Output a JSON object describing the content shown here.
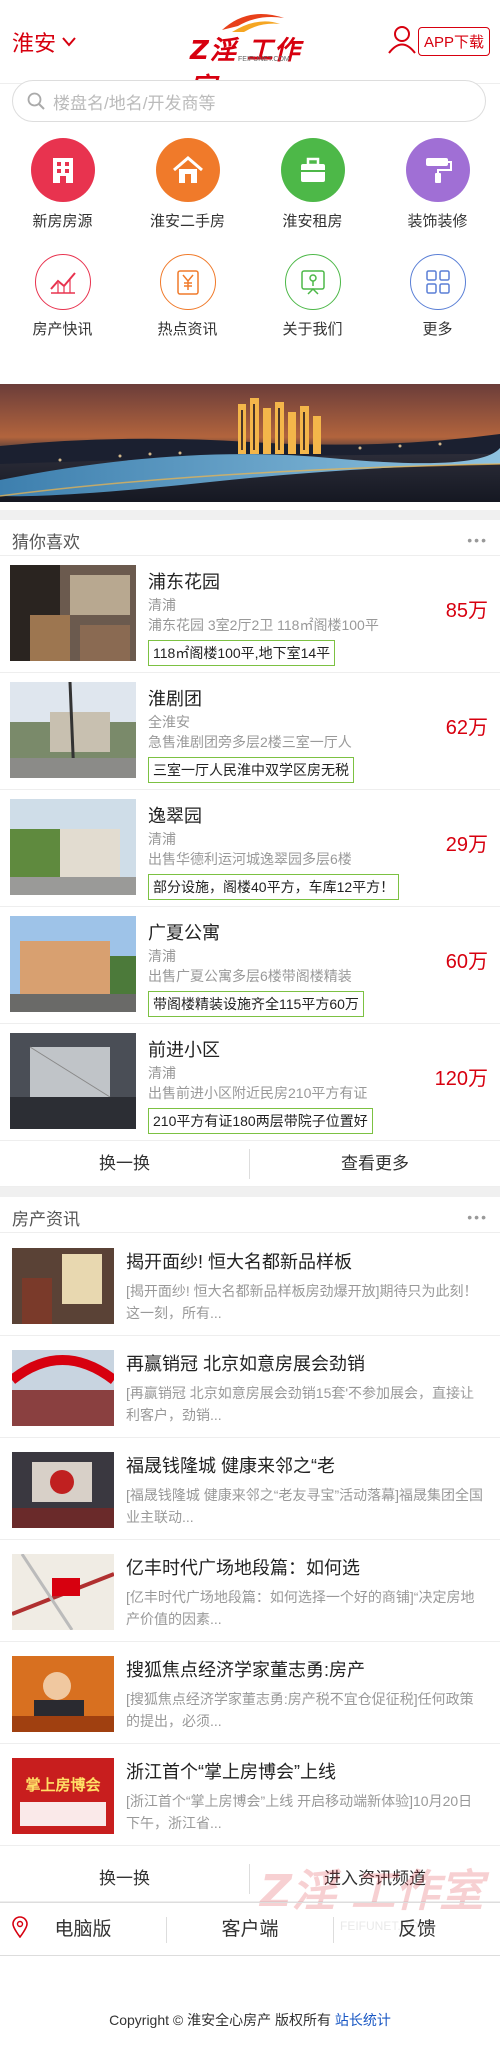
{
  "header": {
    "city": "淮安",
    "logo_brand": "Z淫 工作室",
    "logo_sub": "FEIFUNET.COM",
    "app_download": "APP下载"
  },
  "search": {
    "placeholder": "楼盘名/地名/开发商等"
  },
  "nav": [
    {
      "label": "新房房源",
      "icon": "building-icon",
      "color": "#e8334f"
    },
    {
      "label": "淮安二手房",
      "icon": "house-icon",
      "color": "#f07a2a"
    },
    {
      "label": "淮安租房",
      "icon": "briefcase-icon",
      "color": "#4db848"
    },
    {
      "label": "装饰装修",
      "icon": "paint-roller-icon",
      "color": "#a06fd5"
    },
    {
      "label": "房产快讯",
      "icon": "chart-icon",
      "color": "#e8334f"
    },
    {
      "label": "热点资讯",
      "icon": "yen-icon",
      "color": "#f07a2a"
    },
    {
      "label": "关于我们",
      "icon": "info-board-icon",
      "color": "#4db848"
    },
    {
      "label": "更多",
      "icon": "grid-icon",
      "color": "#5a7fd6"
    }
  ],
  "guess": {
    "title": "猜你喜欢",
    "more": "•••",
    "items": [
      {
        "name": "浦东花园",
        "area": "清浦",
        "desc": "浦东花园 3室2厅2卫 118㎡阁楼100平",
        "tag": "118㎡阁楼100平,地下室14平",
        "price": "85万"
      },
      {
        "name": "淮剧团",
        "area": "全淮安",
        "desc": "急售淮剧团旁多层2楼三室一厅人",
        "tag": "三室一厅人民淮中双学区房无税",
        "price": "62万"
      },
      {
        "name": "逸翠园",
        "area": "清浦",
        "desc": "出售华德利运河城逸翠园多层6楼",
        "tag": "部分设施，阁楼40平方，车库12平方！",
        "price": "29万"
      },
      {
        "name": "广夏公寓",
        "area": "清浦",
        "desc": "出售广夏公寓多层6楼带阁楼精装",
        "tag": "带阁楼精装设施齐全115平方60万",
        "price": "60万"
      },
      {
        "name": "前进小区",
        "area": "清浦",
        "desc": "出售前进小区附近民房210平方有证",
        "tag": "210平方有证180两层带院子位置好",
        "price": "120万"
      }
    ],
    "btn_refresh": "换一换",
    "btn_more": "查看更多"
  },
  "news": {
    "title": "房产资讯",
    "more": "•••",
    "items": [
      {
        "title": "揭开面纱! 恒大名都新品样板",
        "desc": "[揭开面纱! 恒大名都新品样板房劲爆开放]期待只为此刻！这一刻，所有..."
      },
      {
        "title": "再赢销冠 北京如意房展会劲销",
        "desc": "[再赢销冠 北京如意房展会劲销15套'不参加展会，直接让利客户，劲销..."
      },
      {
        "title": "福晟钱隆城 健康来邻之“老",
        "desc": "[福晟钱隆城 健康来邻之“老友寻宝”活动落幕]福晟集团全国业主联动..."
      },
      {
        "title": "亿丰时代广场地段篇：如何选",
        "desc": "[亿丰时代广场地段篇：如何选择一个好的商铺]“决定房地产价值的因素..."
      },
      {
        "title": "搜狐焦点经济学家董志勇:房产",
        "desc": "[搜狐焦点经济学家董志勇:房产税不宜仓促征税]任何政策的提出，必须..."
      },
      {
        "title": "浙江首个“掌上房博会”上线",
        "desc": "[浙江首个“掌上房博会”上线 开启移动端新体验]10月20日下午，浙江省..."
      }
    ],
    "btn_refresh": "换一换",
    "btn_channel": "进入资讯频道"
  },
  "footer": {
    "pc": "电脑版",
    "client": "客户端",
    "feedback": "反馈",
    "copyright": "Copyright © 淮安全心房产 版权所有",
    "stats": "站长统计",
    "watermark": "Z淫 工作室",
    "watermark_sub": "FEIFUNET.COM"
  },
  "images": {
    "news6_text": "掌上房博会"
  }
}
